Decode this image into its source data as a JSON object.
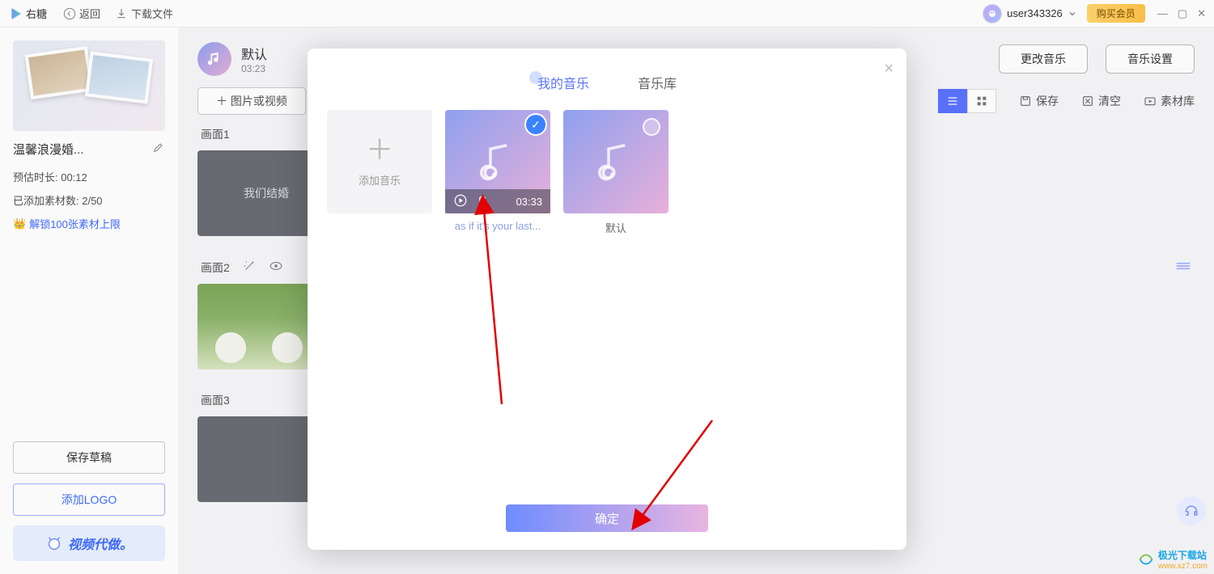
{
  "topbar": {
    "app_name": "右糖",
    "back": "返回",
    "download": "下载文件",
    "username": "user343326",
    "vip": "购买会员"
  },
  "sidebar": {
    "project_title": "温馨浪漫婚...",
    "duration_label": "预估时长: 00:12",
    "assets_label": "已添加素材数: 2/50",
    "unlock": "解锁100张素材上限",
    "save_draft": "保存草稿",
    "add_logo": "添加LOGO",
    "promo": "视频代做。"
  },
  "header": {
    "track_name": "默认",
    "track_duration": "03:23",
    "change_music": "更改音乐",
    "music_settings": "音乐设置"
  },
  "toolbar": {
    "add_media": "＋ 图片或视频",
    "save": "保存",
    "clear": "清空",
    "library": "素材库"
  },
  "scenes": {
    "s1_label": "画面1",
    "s1_text": "我们结婚",
    "s2_label": "画面2",
    "s3_label": "画面3"
  },
  "modal": {
    "tab_my": "我的音乐",
    "tab_lib": "音乐库",
    "add_music": "添加音乐",
    "item1_label": "as if it's your last...",
    "item1_dur": "03:33",
    "item2_label": "默认",
    "confirm": "确定"
  },
  "watermark": {
    "line1": "极光下载站",
    "line2": "www.xz7.com"
  }
}
